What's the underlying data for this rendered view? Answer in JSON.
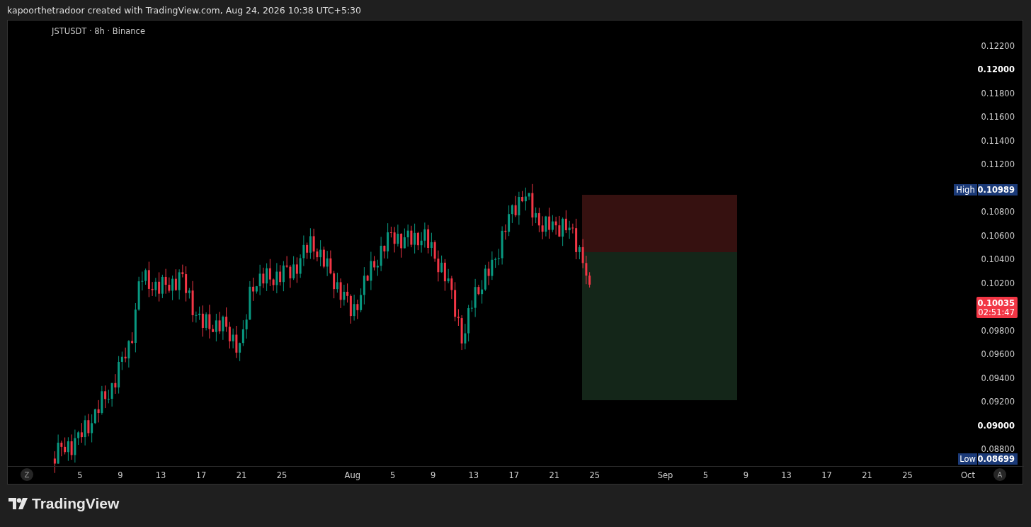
{
  "header": {
    "text": "kapoorthetradoor created with TradingView.com, Aug 24, 2026 10:38 UTC+5:30"
  },
  "chart": {
    "legend": "JSTUSDT · 8h · Binance",
    "price_ticks": [
      {
        "label": "0.12200",
        "bold": false
      },
      {
        "label": "0.12000",
        "bold": true
      },
      {
        "label": "0.11800",
        "bold": false
      },
      {
        "label": "0.11600",
        "bold": false
      },
      {
        "label": "0.11400",
        "bold": false
      },
      {
        "label": "0.11200",
        "bold": false
      },
      {
        "label": "0.10800",
        "bold": false
      },
      {
        "label": "0.10600",
        "bold": false
      },
      {
        "label": "0.10400",
        "bold": false
      },
      {
        "label": "0.10200",
        "bold": false
      },
      {
        "label": "0.09800",
        "bold": false
      },
      {
        "label": "0.09600",
        "bold": false
      },
      {
        "label": "0.09400",
        "bold": false
      },
      {
        "label": "0.09200",
        "bold": false
      },
      {
        "label": "0.09000",
        "bold": true
      },
      {
        "label": "0.08800",
        "bold": false
      }
    ],
    "high": {
      "label": "High",
      "value": "0.10989"
    },
    "low": {
      "label": "Low",
      "value": "0.08699"
    },
    "last_price": {
      "value": "0.10035",
      "countdown": "02:51:47"
    },
    "time_labels": [
      "5",
      "9",
      "13",
      "17",
      "21",
      "25",
      "Aug",
      "5",
      "9",
      "13",
      "17",
      "21",
      "25",
      "Sep",
      "5",
      "9",
      "13",
      "17",
      "21",
      "25",
      "Oct"
    ],
    "left_button": "Z",
    "right_button": "A"
  },
  "footer": {
    "brand": "TradingView"
  }
}
